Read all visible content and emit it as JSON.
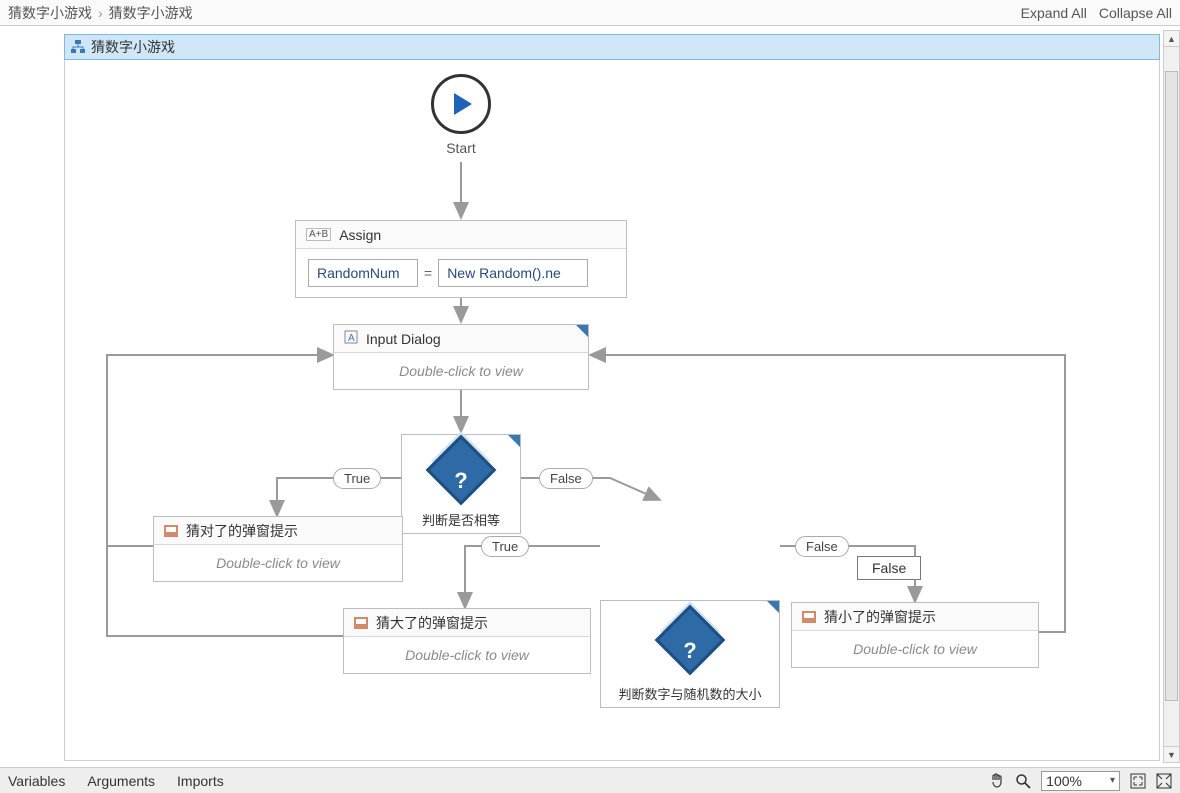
{
  "breadcrumb": {
    "a": "猜数字小游戏",
    "b": "猜数字小游戏"
  },
  "toolbar": {
    "expand": "Expand All",
    "collapse": "Collapse All"
  },
  "flowchart_title": "猜数字小游戏",
  "start_label": "Start",
  "assign": {
    "title": "Assign",
    "icon_text": "A+B",
    "left": "RandomNum",
    "eq": "=",
    "right": "New Random().ne"
  },
  "input_dialog": {
    "title": "Input Dialog",
    "hint": "Double-click to view"
  },
  "decision1": {
    "label": "判断是否相等",
    "true": "True",
    "false": "False"
  },
  "decision2": {
    "label": "判断数字与随机数的大小",
    "true": "True",
    "false": "False"
  },
  "msg_correct": {
    "title": "猜对了的弹窗提示",
    "hint": "Double-click to view"
  },
  "msg_big": {
    "title": "猜大了的弹窗提示",
    "hint": "Double-click to view"
  },
  "msg_small": {
    "title": "猜小了的弹窗提示",
    "hint": "Double-click to view"
  },
  "tooltip": "False",
  "icons": {
    "ab": "A+B"
  },
  "bottom": {
    "variables": "Variables",
    "arguments": "Arguments",
    "imports": "Imports",
    "zoom": "100%"
  }
}
